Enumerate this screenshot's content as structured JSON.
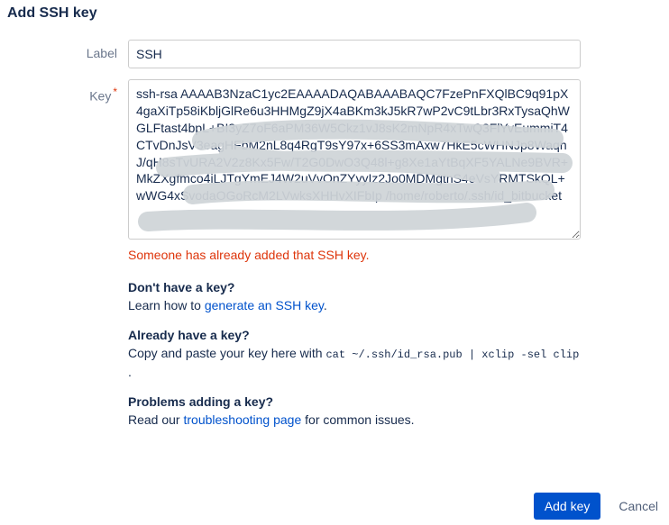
{
  "title": "Add SSH key",
  "form": {
    "label_field": {
      "label": "Label",
      "value": "SSH"
    },
    "key_field": {
      "label": "Key",
      "required_mark": "*",
      "value": "ssh-rsa AAAAB3NzaC1yc2EAAAADAQABAAABAQC7FzePnFXQlBC9q91pX4gaXiTp58iKbljGlRe6u3HHMgZ9jX4aBKm3kJ5kR7wP2vC9tLbr3RxTysaQhWGLFtast4bpL+BI3yZ7oF6aPM36W5Ckz1vJ8sK2mNpR4xTwQ3FlYvEummiT4CTvDnJsV3eagHFbM2nL8q4RgT9sY97x+6SS3mAxw7HkE5cWHNJp8WaqnJ/qH8sTvURA2V2z8Kx5Fw/T2G0DwO3Q48l+g8Xe1aYtBqXF5YALNe9BVR+MkZXgfmco4iLJTgYmEJ4W2uVvOnZYyyIz2Jo0MDMgtnS4eVsYRMTSkQL+wWG4xSvodaOGoRcM2LVwksXHHvXIFbIp /home/roberto/.ssh/id_bitbucket"
    },
    "error": "Someone has already added that SSH key."
  },
  "help": {
    "no_key": {
      "heading": "Don't have a key?",
      "text_before": "Learn how to ",
      "link": "generate an SSH key",
      "text_after": "."
    },
    "have_key": {
      "heading": "Already have a key?",
      "text_before": "Copy and paste your key here with ",
      "code": "cat ~/.ssh/id_rsa.pub | xclip -sel clip",
      "text_after": " ."
    },
    "problems": {
      "heading": "Problems adding a key?",
      "text_before": "Read our ",
      "link": "troubleshooting page",
      "text_after": " for common issues."
    }
  },
  "actions": {
    "primary": "Add key",
    "cancel": "Cancel"
  }
}
